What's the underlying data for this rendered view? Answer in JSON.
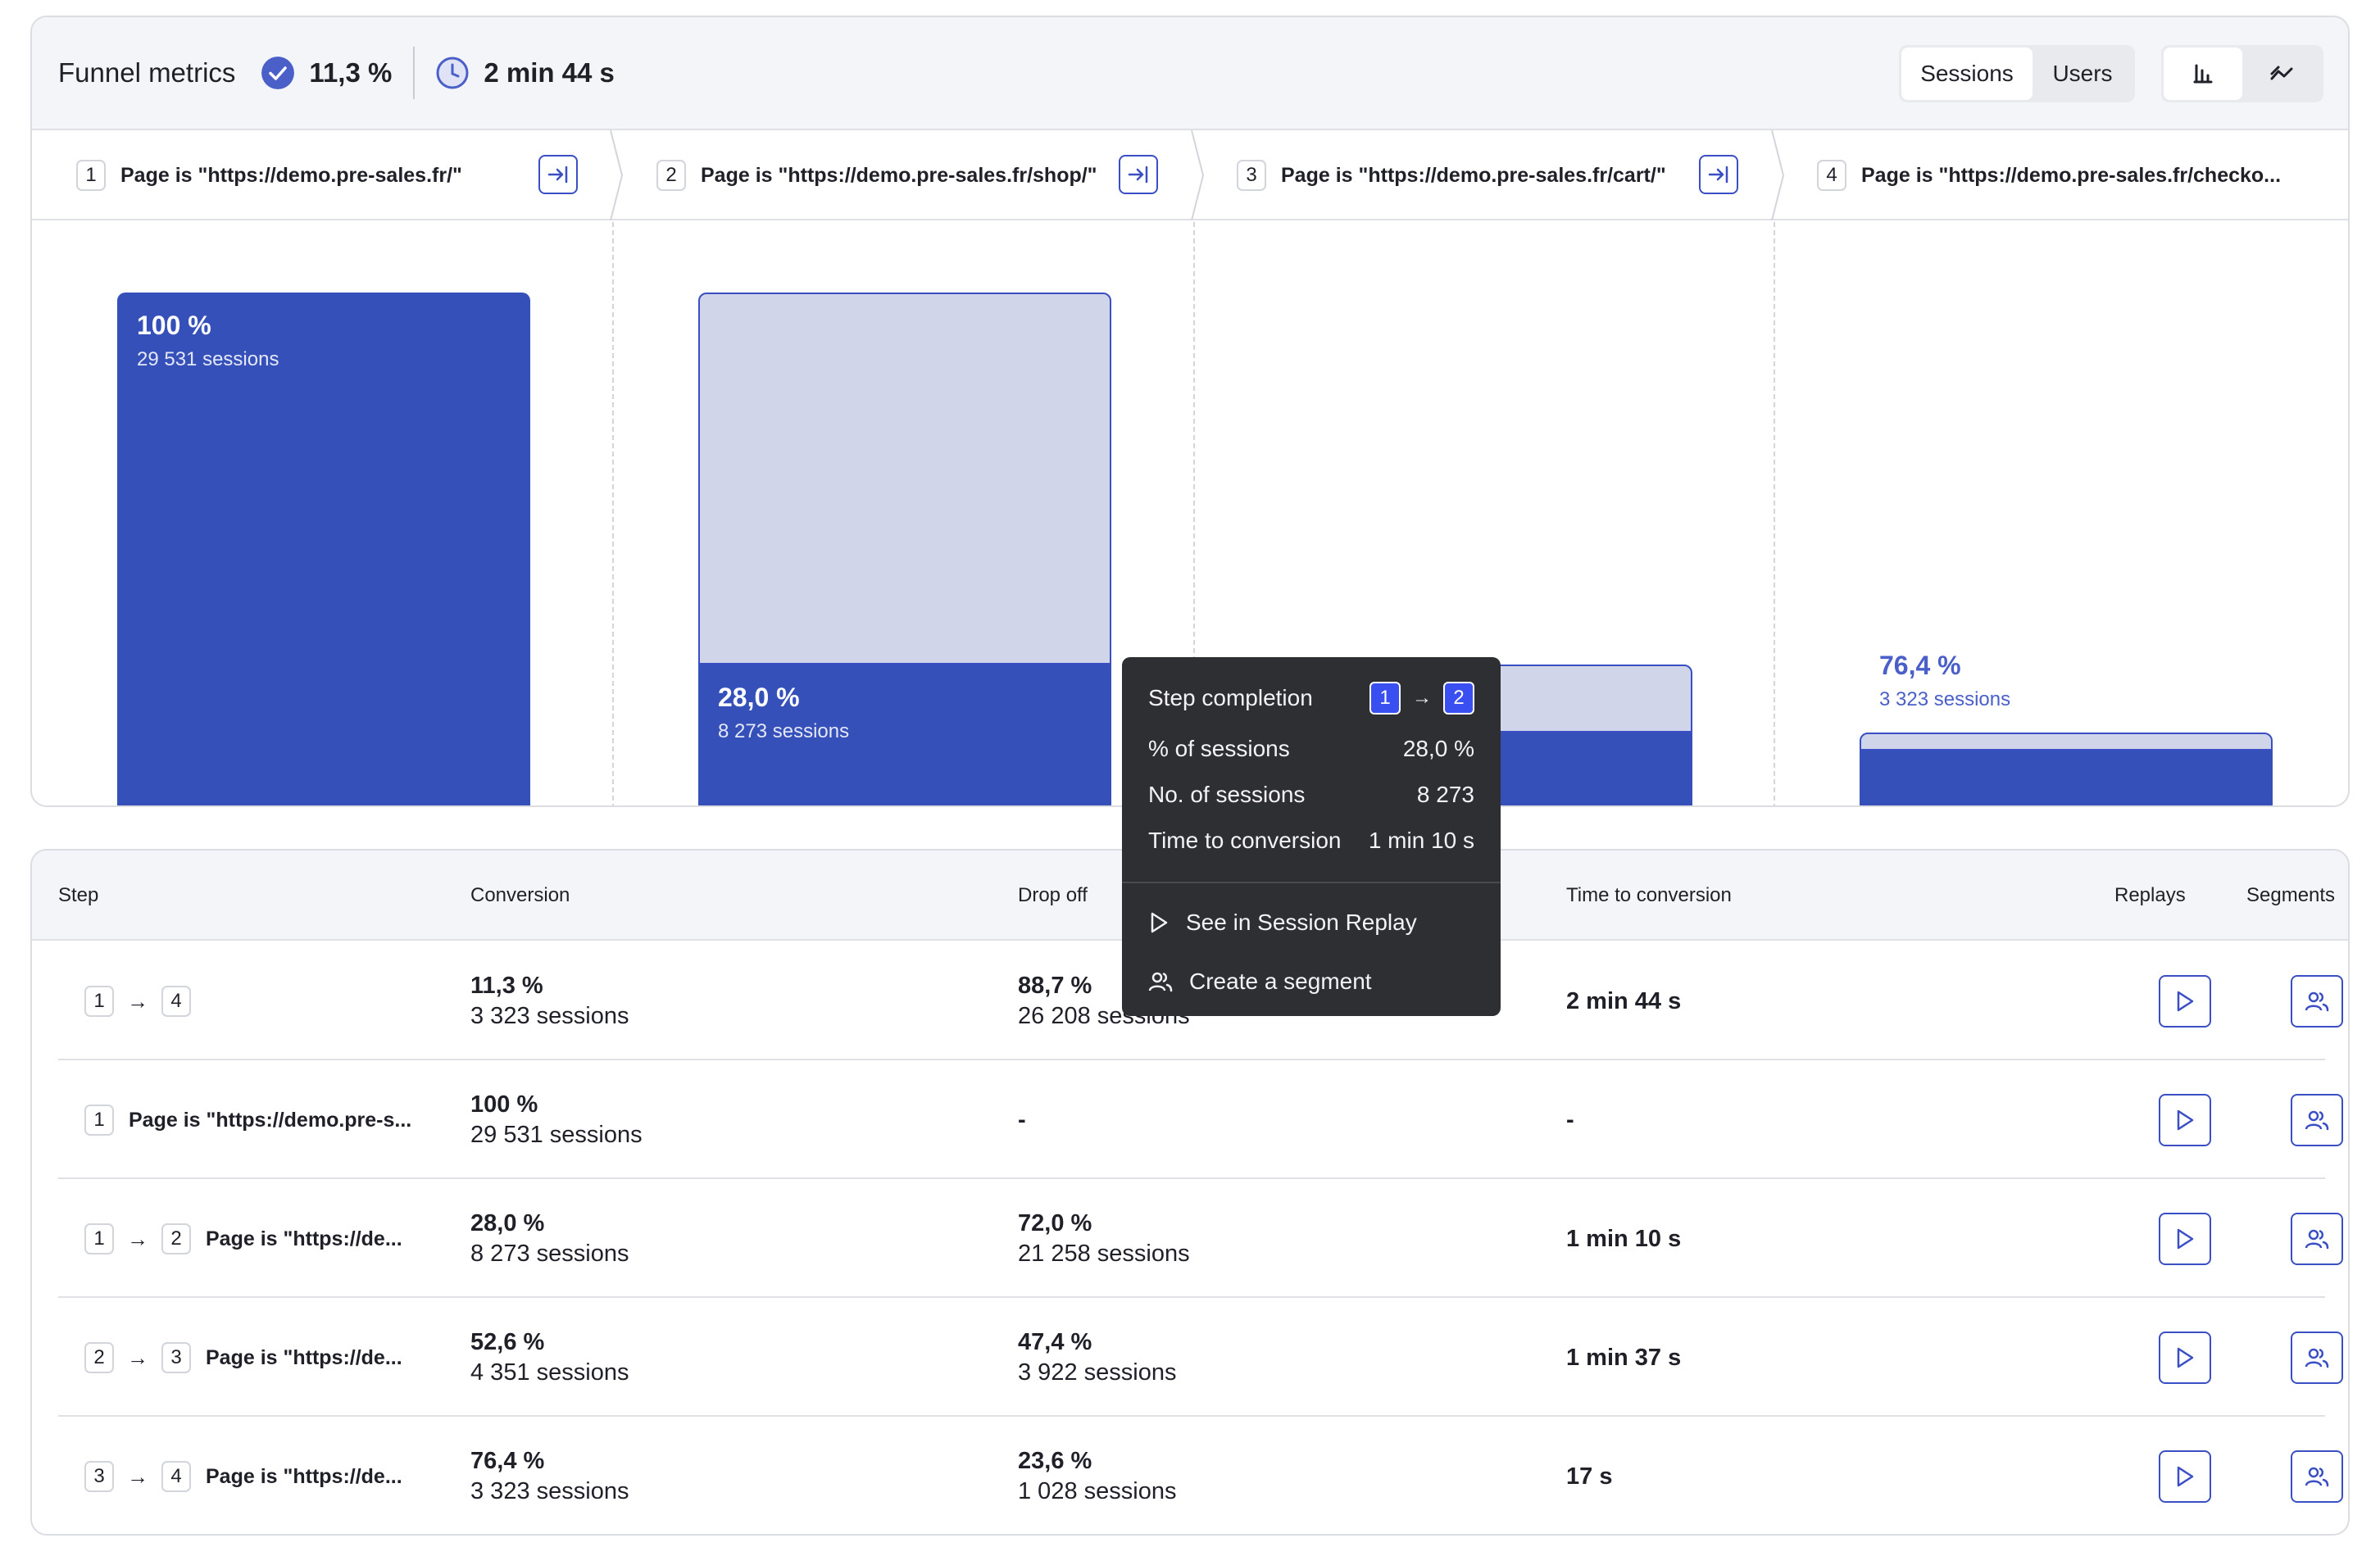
{
  "header": {
    "title": "Funnel metrics",
    "conversion": "11,3 %",
    "time": "2 min 44 s",
    "toggle_sessions": "Sessions",
    "toggle_users": "Users"
  },
  "steps": [
    {
      "num": "1",
      "label": "Page is \"https://demo.pre-sales.fr/\""
    },
    {
      "num": "2",
      "label": "Page is \"https://demo.pre-sales.fr/shop/\""
    },
    {
      "num": "3",
      "label": "Page is \"https://demo.pre-sales.fr/cart/\""
    },
    {
      "num": "4",
      "label": "Page is \"https://demo.pre-sales.fr/checko..."
    }
  ],
  "chart_data": {
    "type": "bar",
    "categories": [
      "1",
      "2",
      "3",
      "4"
    ],
    "series": [
      {
        "values": [
          100,
          28.0,
          14.7,
          11.3
        ]
      }
    ],
    "labels": [
      {
        "pct": "100 %",
        "sessions": "29 531 sessions"
      },
      {
        "pct": "28,0 %",
        "sessions": "8 273 sessions"
      },
      {
        "pct": "",
        "sessions": ""
      },
      {
        "pct": "76,4 %",
        "sessions": "3 323 sessions"
      }
    ],
    "previous_step_values": [
      null,
      100,
      28.0,
      14.7
    ],
    "ylim": [
      0,
      100
    ]
  },
  "tooltip": {
    "title": "Step completion",
    "from": "1",
    "to": "2",
    "rows": [
      {
        "label": "% of sessions",
        "value": "28,0 %"
      },
      {
        "label": "No. of sessions",
        "value": "8 273"
      },
      {
        "label": "Time to conversion",
        "value": "1 min 10 s"
      }
    ],
    "action_replay": "See in Session Replay",
    "action_segment": "Create a segment"
  },
  "table": {
    "headers": {
      "step": "Step",
      "conversion": "Conversion",
      "dropoff": "Drop off",
      "time": "Time to conversion",
      "replays": "Replays",
      "segments": "Segments"
    },
    "rows": [
      {
        "from": "1",
        "to": "4",
        "label": "",
        "conv_pct": "11,3 %",
        "conv_sess": "3 323 sessions",
        "drop_pct": "88,7 %",
        "drop_sess": "26 208 sessions",
        "time": "2 min 44 s"
      },
      {
        "from": "1",
        "to": "",
        "label": "Page is \"https://demo.pre-s...",
        "conv_pct": "100 %",
        "conv_sess": "29 531 sessions",
        "drop_pct": "-",
        "drop_sess": "",
        "time": "-"
      },
      {
        "from": "1",
        "to": "2",
        "label": "Page is \"https://de...",
        "conv_pct": "28,0 %",
        "conv_sess": "8 273 sessions",
        "drop_pct": "72,0 %",
        "drop_sess": "21 258 sessions",
        "time": "1 min 10 s"
      },
      {
        "from": "2",
        "to": "3",
        "label": "Page is \"https://de...",
        "conv_pct": "52,6 %",
        "conv_sess": "4 351 sessions",
        "drop_pct": "47,4 %",
        "drop_sess": "3 922 sessions",
        "time": "1 min 37 s"
      },
      {
        "from": "3",
        "to": "4",
        "label": "Page is \"https://de...",
        "conv_pct": "76,4 %",
        "conv_sess": "3 323 sessions",
        "drop_pct": "23,6 %",
        "drop_sess": "1 028 sessions",
        "time": "17 s"
      }
    ]
  },
  "colors": {
    "accent": "#3550b9",
    "ghost": "#d1d5ea",
    "tooltip_bg": "#2e2f33"
  }
}
